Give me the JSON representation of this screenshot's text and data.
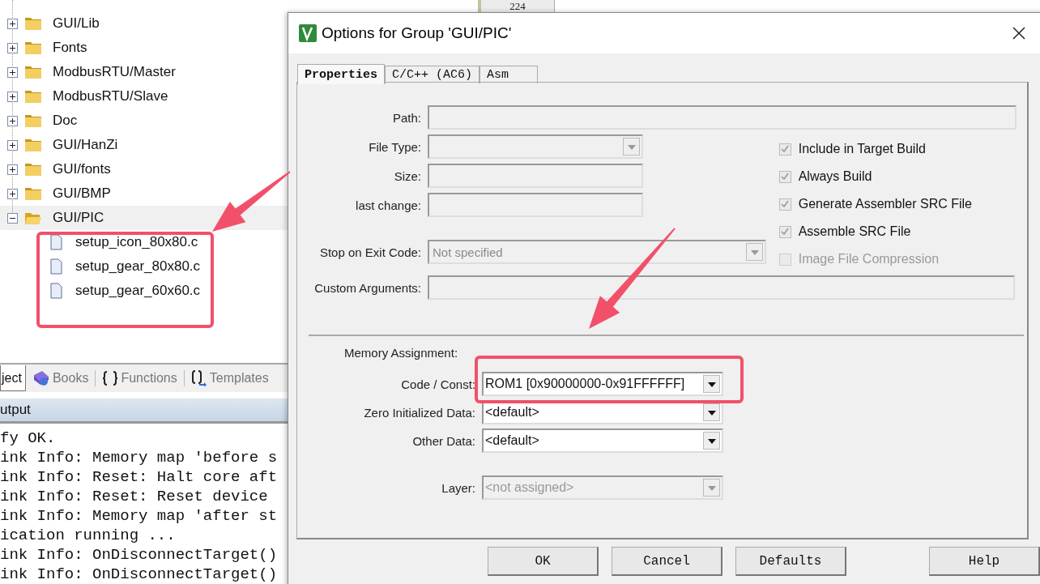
{
  "project_tree": [
    {
      "label": "GUI/Lib",
      "expanded": false,
      "selected": false
    },
    {
      "label": "Fonts",
      "expanded": false,
      "selected": false
    },
    {
      "label": "ModbusRTU/Master",
      "expanded": false,
      "selected": false
    },
    {
      "label": "ModbusRTU/Slave",
      "expanded": false,
      "selected": false
    },
    {
      "label": "Doc",
      "expanded": false,
      "selected": false
    },
    {
      "label": "GUI/HanZi",
      "expanded": false,
      "selected": false
    },
    {
      "label": "GUI/fonts",
      "expanded": false,
      "selected": false
    },
    {
      "label": "GUI/BMP",
      "expanded": false,
      "selected": false
    },
    {
      "label": "GUI/PIC",
      "expanded": true,
      "selected": true,
      "children": [
        {
          "label": "setup_icon_80x80.c"
        },
        {
          "label": "setup_gear_80x80.c"
        },
        {
          "label": "setup_gear_60x60.c"
        }
      ]
    }
  ],
  "panel_tabs": [
    {
      "label": "ject",
      "kind": "plain",
      "selected": true
    },
    {
      "label": "Books",
      "kind": "book",
      "selected": false
    },
    {
      "label": "Functions",
      "kind": "braces",
      "selected": false
    },
    {
      "label": "Templates",
      "kind": "template",
      "selected": false
    }
  ],
  "output": {
    "title": "utput",
    "lines": [
      "fy OK.",
      "ink Info: Memory map 'before s",
      "ink Info: Reset: Halt core aft",
      "ink Info: Reset: Reset device ",
      "ink Info: Memory map 'after st",
      "ication running ...",
      "ink Info: OnDisconnectTarget()",
      "ink Info: OnDisconnectTarget()"
    ]
  },
  "editor": {
    "line_number": "224"
  },
  "dialog": {
    "title": "Options for Group 'GUI/PIC'",
    "tabs": [
      {
        "label": "Properties",
        "selected": true
      },
      {
        "label": "C/C++ (AC6)",
        "selected": false
      },
      {
        "label": "Asm",
        "selected": false
      }
    ],
    "path": {
      "label": "Path:"
    },
    "file_type": {
      "label": "File Type:"
    },
    "size": {
      "label": "Size:"
    },
    "last_change": {
      "label": "last change:"
    },
    "stop_on_exit_code": {
      "label": "Stop on Exit Code:",
      "value": "Not specified"
    },
    "custom_arguments": {
      "label": "Custom Arguments:"
    },
    "checkboxes": [
      {
        "label": "Include in Target Build",
        "checked": true,
        "disabled": false
      },
      {
        "label": "Always Build",
        "checked": true,
        "disabled": false
      },
      {
        "label": "Generate Assembler SRC File",
        "checked": true,
        "disabled": false
      },
      {
        "label": "Assemble SRC File",
        "checked": true,
        "disabled": false
      },
      {
        "label": "Image File Compression",
        "checked": false,
        "disabled": true
      }
    ],
    "memory_assignment": {
      "heading": "Memory Assignment:",
      "selects": [
        {
          "label": "Code / Const:",
          "value": "ROM1 [0x90000000-0x91FFFFFF]",
          "disabled": false
        },
        {
          "label": "Zero Initialized Data:",
          "value": "<default>",
          "disabled": false
        },
        {
          "label": "Other Data:",
          "value": "<default>",
          "disabled": false
        },
        {
          "label": "Layer:",
          "value": "<not assigned>",
          "disabled": true
        }
      ]
    },
    "buttons": [
      "OK",
      "Cancel",
      "Defaults",
      "Help"
    ]
  }
}
